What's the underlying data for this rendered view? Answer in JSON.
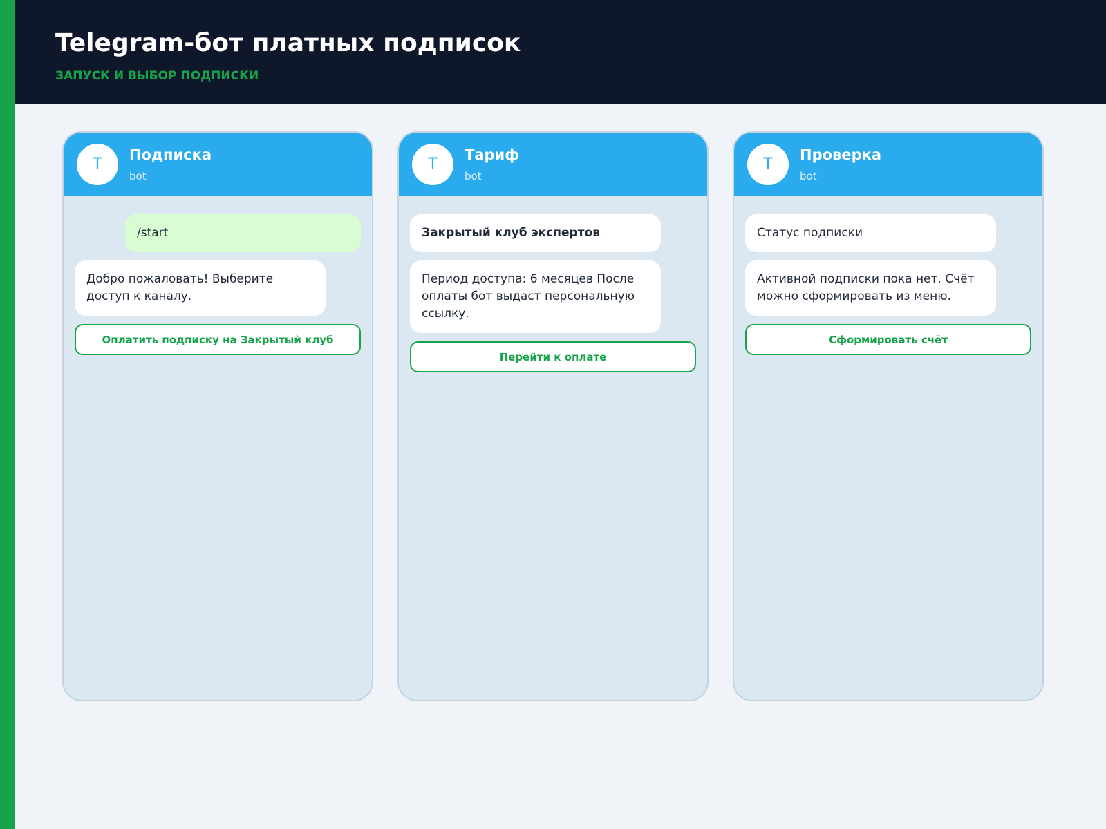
{
  "page": {
    "title": "Telegram-бот платных подписок",
    "subtitle": "ЗАПУСК И ВЫБОР ПОДПИСКИ"
  },
  "colors": {
    "accent": "#16a34a",
    "header_bg": "#0f172a",
    "telegram_blue": "#2aabee",
    "chat_bg": "#dbe7f1",
    "outgoing_bubble": "#d9fdd3"
  },
  "panels": [
    {
      "chat_name": "Подписка",
      "status": "bot",
      "avatar_letter": "T",
      "messages": [
        {
          "direction": "out",
          "text": "/start"
        },
        {
          "direction": "in",
          "text": "Добро пожаловать! Выберите доступ к каналу."
        }
      ],
      "button_label": "Оплатить подписку на Закрытый клуб"
    },
    {
      "chat_name": "Тариф",
      "status": "bot",
      "avatar_letter": "T",
      "messages": [
        {
          "direction": "in",
          "text": "Закрытый клуб экспертов"
        },
        {
          "direction": "in",
          "text": "Период доступа: 6 месяцев После оплаты бот выдаст персональную ссылку."
        }
      ],
      "button_label": "Перейти к оплате"
    },
    {
      "chat_name": "Проверка",
      "status": "bot",
      "avatar_letter": "T",
      "messages": [
        {
          "direction": "in",
          "text": "Статус подписки"
        },
        {
          "direction": "in",
          "text": "Активной подписки пока нет. Счёт можно сформировать из меню."
        }
      ],
      "button_label": "Сформировать счёт"
    }
  ]
}
